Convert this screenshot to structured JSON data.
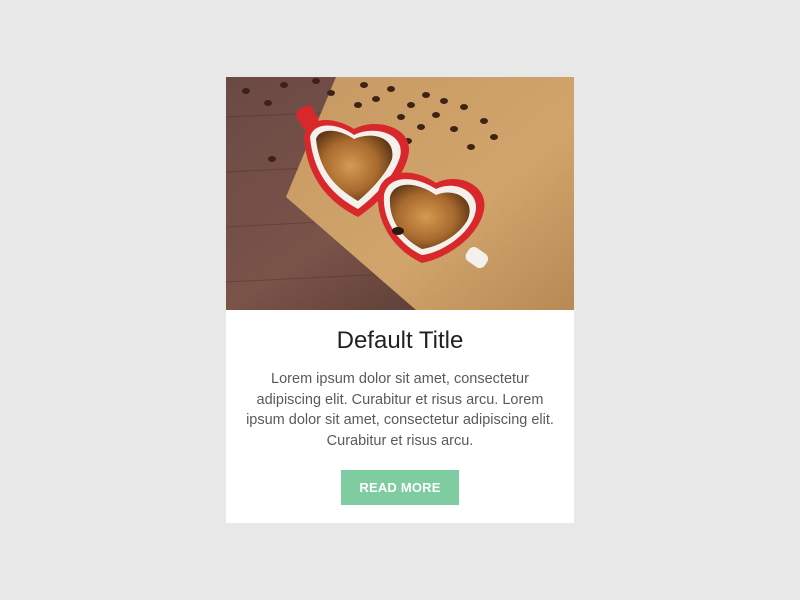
{
  "card": {
    "image_alt": "Two heart-shaped coffee cups on burlap with coffee beans",
    "title": "Default Title",
    "body": "Lorem ipsum dolor sit amet, consectetur adipiscing elit. Curabitur et risus arcu. Lorem ipsum dolor sit amet, consectetur adipiscing elit. Curabitur et risus arcu.",
    "button_label": "READ MORE"
  },
  "colors": {
    "page_background": "#e8e8e8",
    "card_background": "#ffffff",
    "button_accent": "#7ecc9f",
    "title_text": "#222222",
    "body_text": "#5a5a5a"
  }
}
